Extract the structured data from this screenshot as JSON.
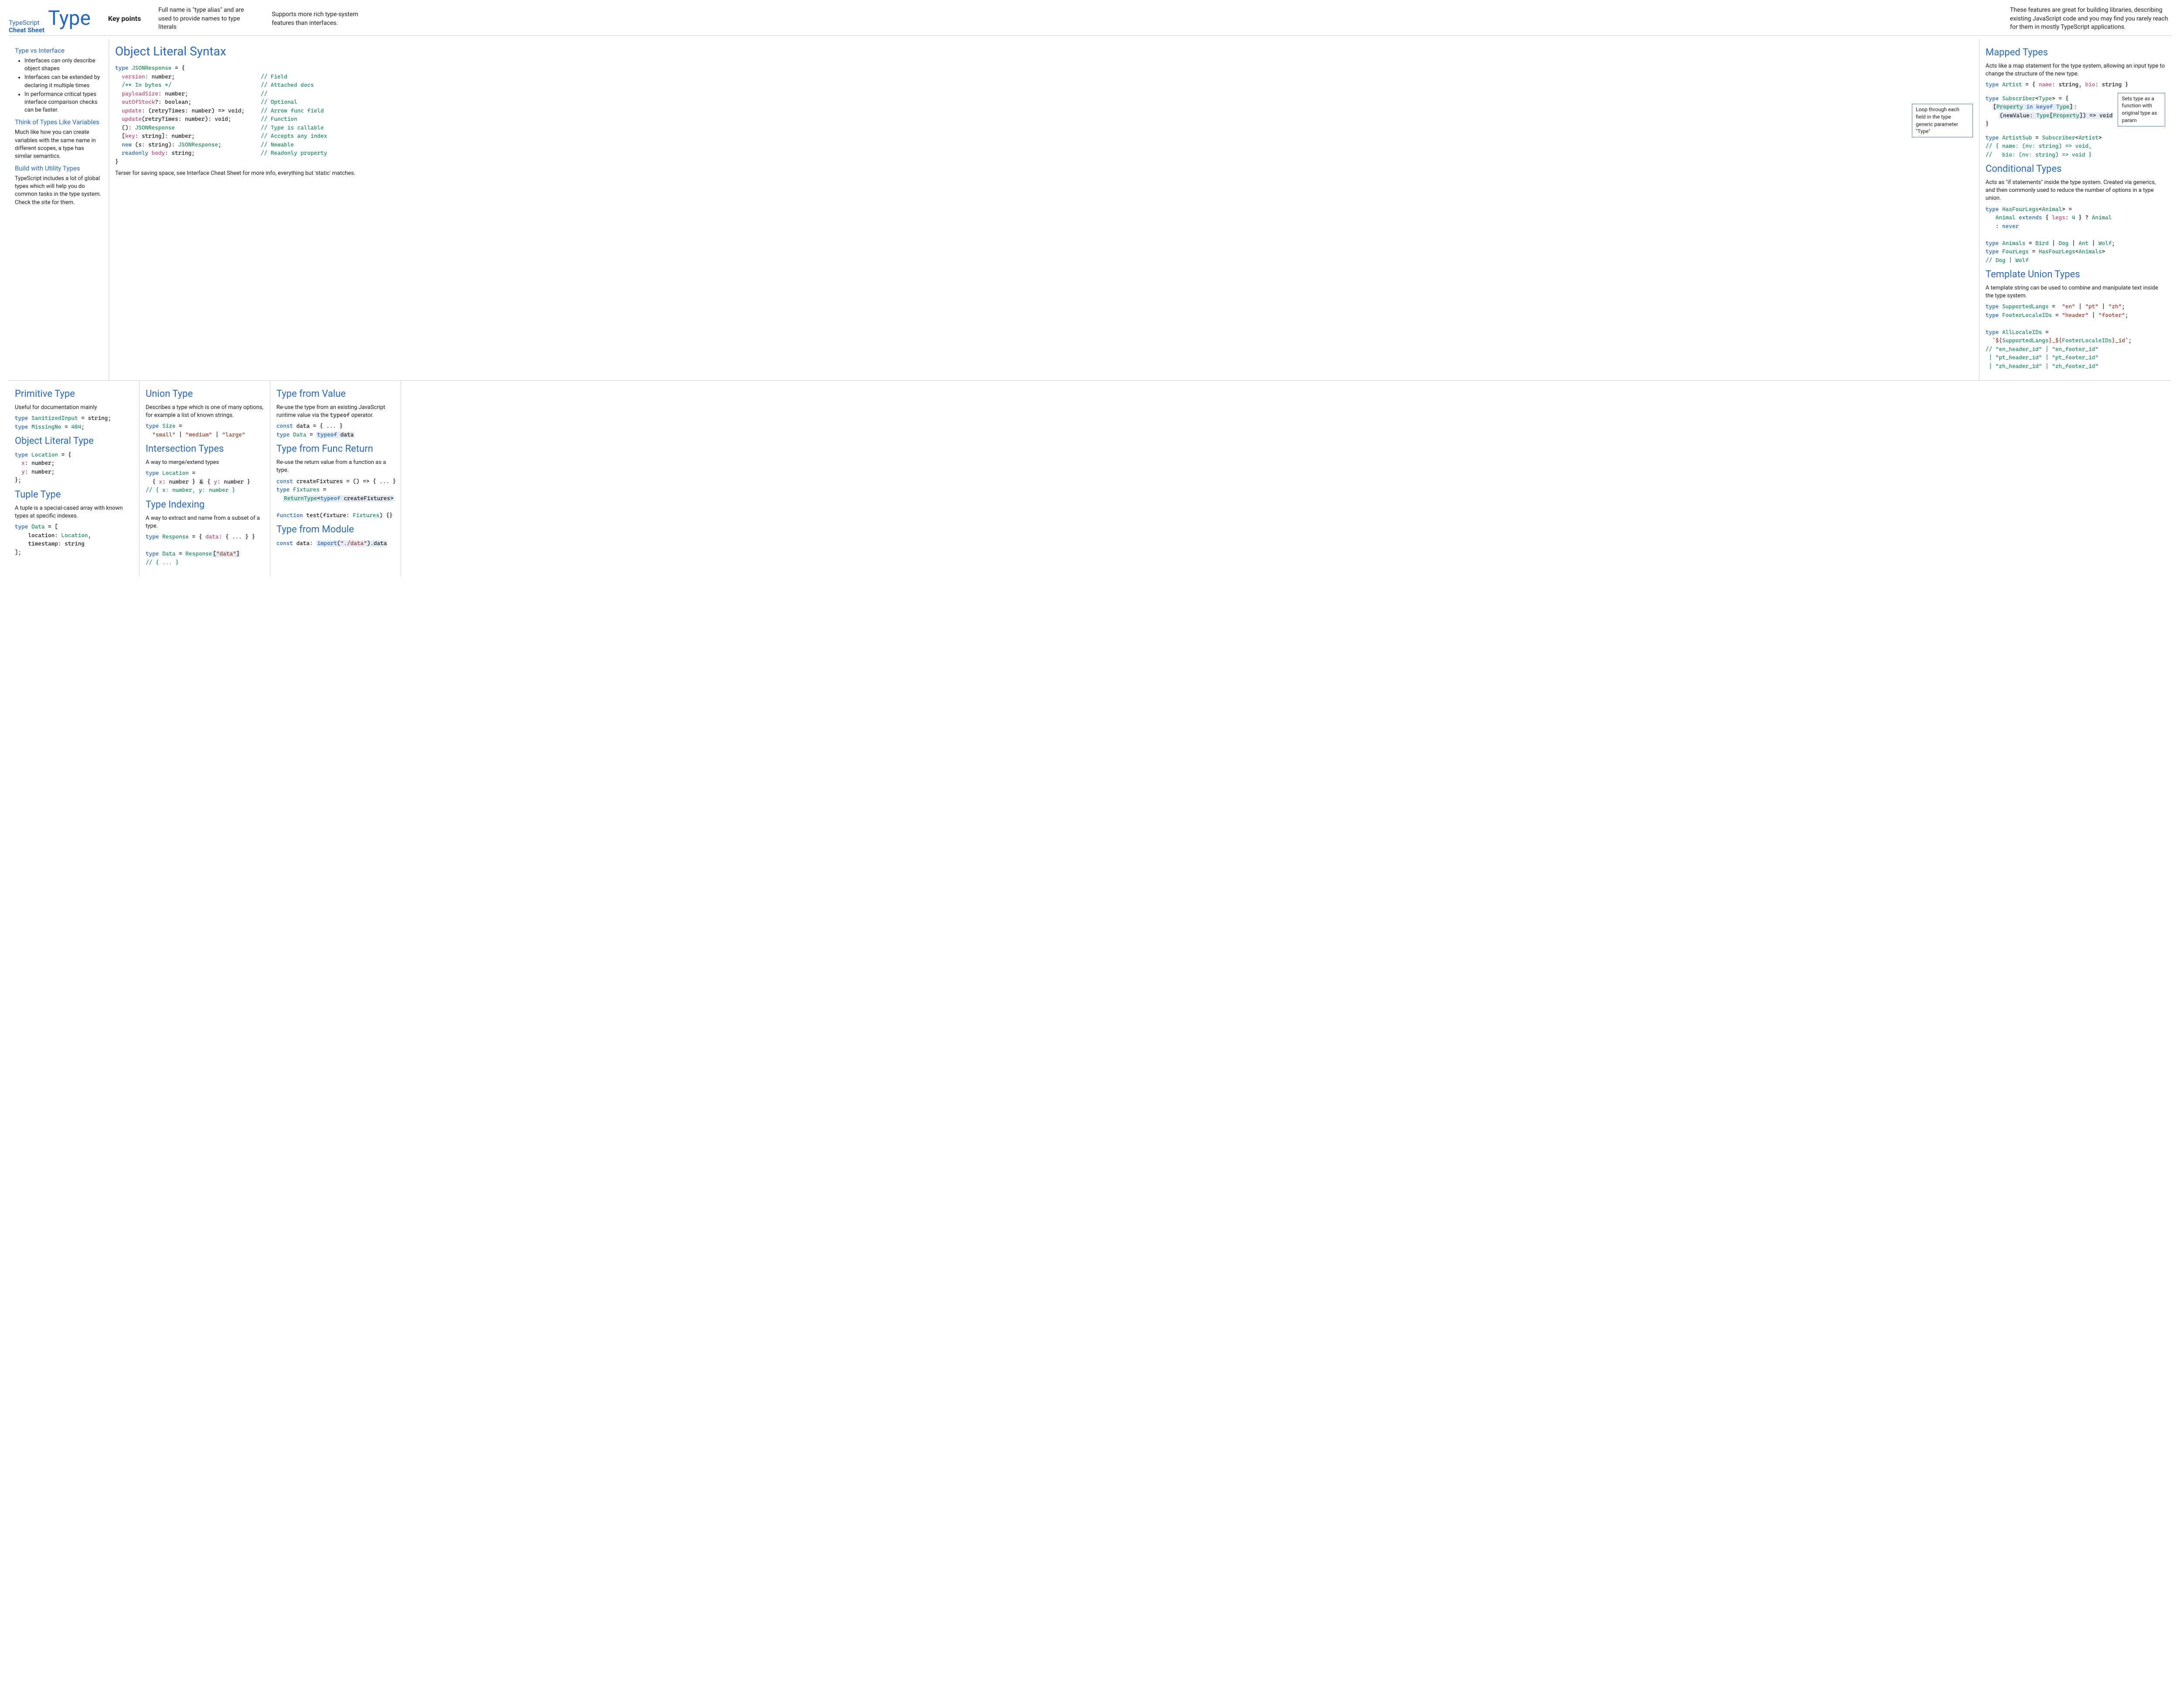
{
  "header": {
    "brand_line1": "TypeScript",
    "brand_line2": "Cheat Sheet",
    "brand_main": "Type",
    "keypoints_label": "Key points",
    "kp1": "Full name is \"type alias\" and are used to provide names to type literals",
    "kp2": "Supports more rich type-system features than interfaces.",
    "kp3": "These features are great for building libraries, describing existing JavaScript code and you may find you rarely reach for them in mostly TypeScript applications."
  },
  "sidebar": {
    "h1": "Type vs Interface",
    "b1": "Interfaces can only describe object shapes",
    "b2": "Interfaces can be extended by declaring it multiple times",
    "b3": "In performance critical types interface comparison checks can be faster.",
    "h2": "Think of Types Like Variables",
    "p2": "Much like how you can create variables with the same name in different scopes, a type has similar semantics.",
    "h3": "Build with Utility Types",
    "p3": "TypeScript includes a lot of global types which will help you do common tasks in the type system. Check the site for them."
  },
  "ols": {
    "title": "Object Literal Syntax",
    "l0": "type JSONResponse = {",
    "l1a": "  version: number;",
    "c1": "// Field",
    "l2a": "  /** In bytes */",
    "c2": "// Attached docs",
    "l3a": "  payloadSize: number;",
    "c3": "//",
    "l4a": "  outOfStock?: boolean;",
    "c4": "// Optional",
    "l5a": "  update: (retryTimes: number) => void;",
    "c5": "// Arrow func field",
    "l6a": "  update(retryTimes: number): void;",
    "c6": "// Function",
    "l7a": "  (): JSONResponse",
    "c7": "// Type is callable",
    "l8a": "  [key: string]: number;",
    "c8": "// Accepts any index",
    "l9a": "  new (s: string): JSONResponse;",
    "c9": "// Newable",
    "l10a": "  readonly body: string;",
    "c10": "// Readonly property",
    "l11": "}",
    "tail": "Terser for saving space, see Interface Cheat Sheet for more info, everything but 'static' matches."
  },
  "mapped": {
    "title": "Mapped Types",
    "desc": "Acts like a map statement for the type system, allowing an input type to change the structure of the new type.",
    "callout1": "Loop through each field in the type generic parameter \"Type\"",
    "callout2": "Sets type as a function with original type as param"
  },
  "cond": {
    "title": "Conditional Types",
    "desc": "Acts as \"if statements\"  inside the type system. Created via generics, and then commonly used to reduce the number of options in a type union."
  },
  "tmpl": {
    "title": "Template Union Types",
    "desc": "A template string can be used to combine and manipulate text inside the type system."
  },
  "prim": {
    "title": "Primitive Type",
    "desc": "Useful for documentation mainly"
  },
  "objlit": {
    "title": "Object Literal Type"
  },
  "tuple": {
    "title": "Tuple Type",
    "desc": "A tuple is a special-cased array with known types at specific indexes."
  },
  "union": {
    "title": "Union Type",
    "desc": "Describes a type which is one of many options, for example a list of known strings."
  },
  "inter": {
    "title": "Intersection Types",
    "desc": "A way to merge/extend types"
  },
  "index": {
    "title": "Type Indexing",
    "desc": "A way to extract and name from a subset of a type."
  },
  "tfv": {
    "title": "Type from Value",
    "desc": "Re-use the type from an existing JavaScript runtime value via the typeof operator."
  },
  "tfr": {
    "title": "Type from Func Return",
    "desc": "Re-use the return value from a function as a type."
  },
  "tfm": {
    "title": "Type from Module"
  }
}
